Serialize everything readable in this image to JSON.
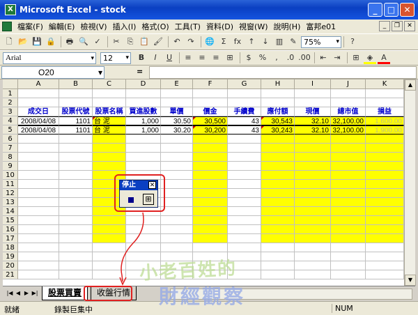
{
  "window": {
    "title": "Microsoft Excel - stock",
    "minimize": "_",
    "maximize": "□",
    "close": "✕"
  },
  "menu": [
    "檔案(F)",
    "編輯(E)",
    "檢視(V)",
    "插入(I)",
    "格式(O)",
    "工具(T)",
    "資料(D)",
    "視窗(W)",
    "說明(H)",
    "富邦e01"
  ],
  "toolbar": {
    "zoom": "75%",
    "font": "Arial",
    "size": "12",
    "bold": "B",
    "italic": "I",
    "underline": "U"
  },
  "namebox": "O20",
  "fx": "=",
  "columns": [
    "A",
    "B",
    "C",
    "D",
    "E",
    "F",
    "G",
    "H",
    "I",
    "J",
    "K"
  ],
  "headers": [
    "成交日",
    "股票代號",
    "股票名稱",
    "買進股數",
    "單價",
    "價金",
    "手續費",
    "應付額",
    "現價",
    "總市值",
    "損益"
  ],
  "rows": [
    [
      "2008/04/08",
      "1101",
      "台 泥",
      "1,000",
      "30.50",
      "30,500",
      "43",
      "30,543",
      "32.10",
      "32,100.00",
      "1,600.00"
    ],
    [
      "2008/04/08",
      "1101",
      "台 泥",
      "1,000",
      "30.20",
      "30,200",
      "43",
      "30,243",
      "32.10",
      "32,100.00",
      "1,900.00"
    ]
  ],
  "row_numbers": [
    "1",
    "2",
    "3",
    "4",
    "5",
    "6",
    "7",
    "8",
    "9",
    "10",
    "11",
    "12",
    "13",
    "14",
    "15",
    "16",
    "17",
    "18",
    "19",
    "20",
    "21"
  ],
  "stop_toolbar": {
    "title": "停止"
  },
  "sheets": [
    "股票買賣",
    "收盤行情"
  ],
  "status": {
    "left": "就緒",
    "middle": "錄製巨集中",
    "num": "NUM"
  },
  "watermark": {
    "line1": "小老百姓的",
    "line2": "財經觀察"
  }
}
